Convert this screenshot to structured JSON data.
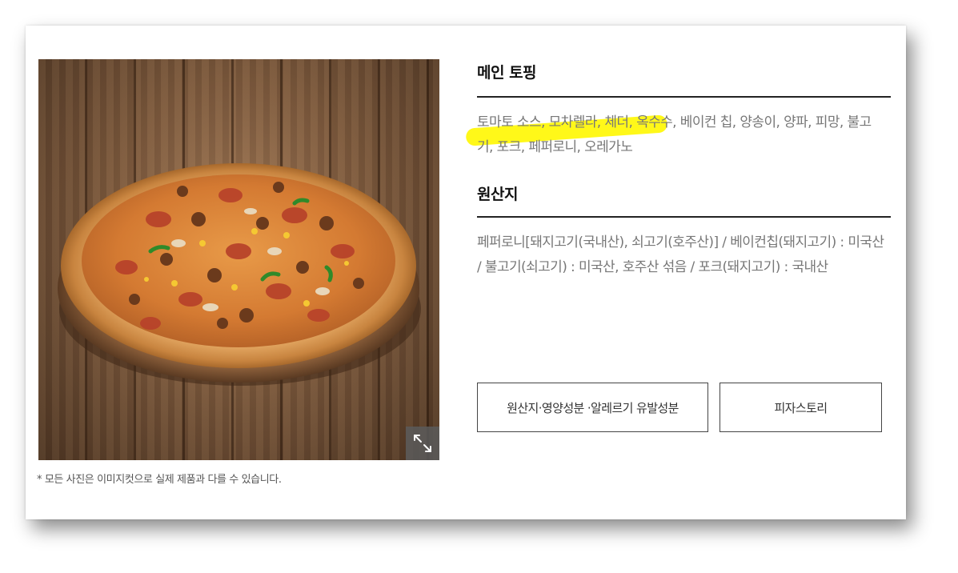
{
  "product": {
    "image_caption": "* 모든 사진은 이미지컷으로 실제 제품과 다를 수 있습니다.",
    "expand_icon": "expand-arrows-icon"
  },
  "sections": {
    "main_topping": {
      "title": "메인 토핑",
      "body": "토마토 소스, 모차렐라, 체더, 옥수수, 베이컨 칩, 양송이, 양파, 피망, 불고기, 포크, 페퍼로니, 오레가노"
    },
    "origin": {
      "title": "원산지",
      "body": "페퍼로니[돼지고기(국내산), 쇠고기(호주산)] / 베이컨칩(돼지고기) : 미국산 / 불고기(쇠고기) : 미국산, 호주산 섞음 / 포크(돼지고기) : 국내산"
    }
  },
  "buttons": {
    "nutrition": "원산지·영양성분 ·알레르기 유발성분",
    "story": "피자스토리"
  },
  "colors": {
    "highlight": "#fff700",
    "body_text": "#777777",
    "title_text": "#111111"
  }
}
